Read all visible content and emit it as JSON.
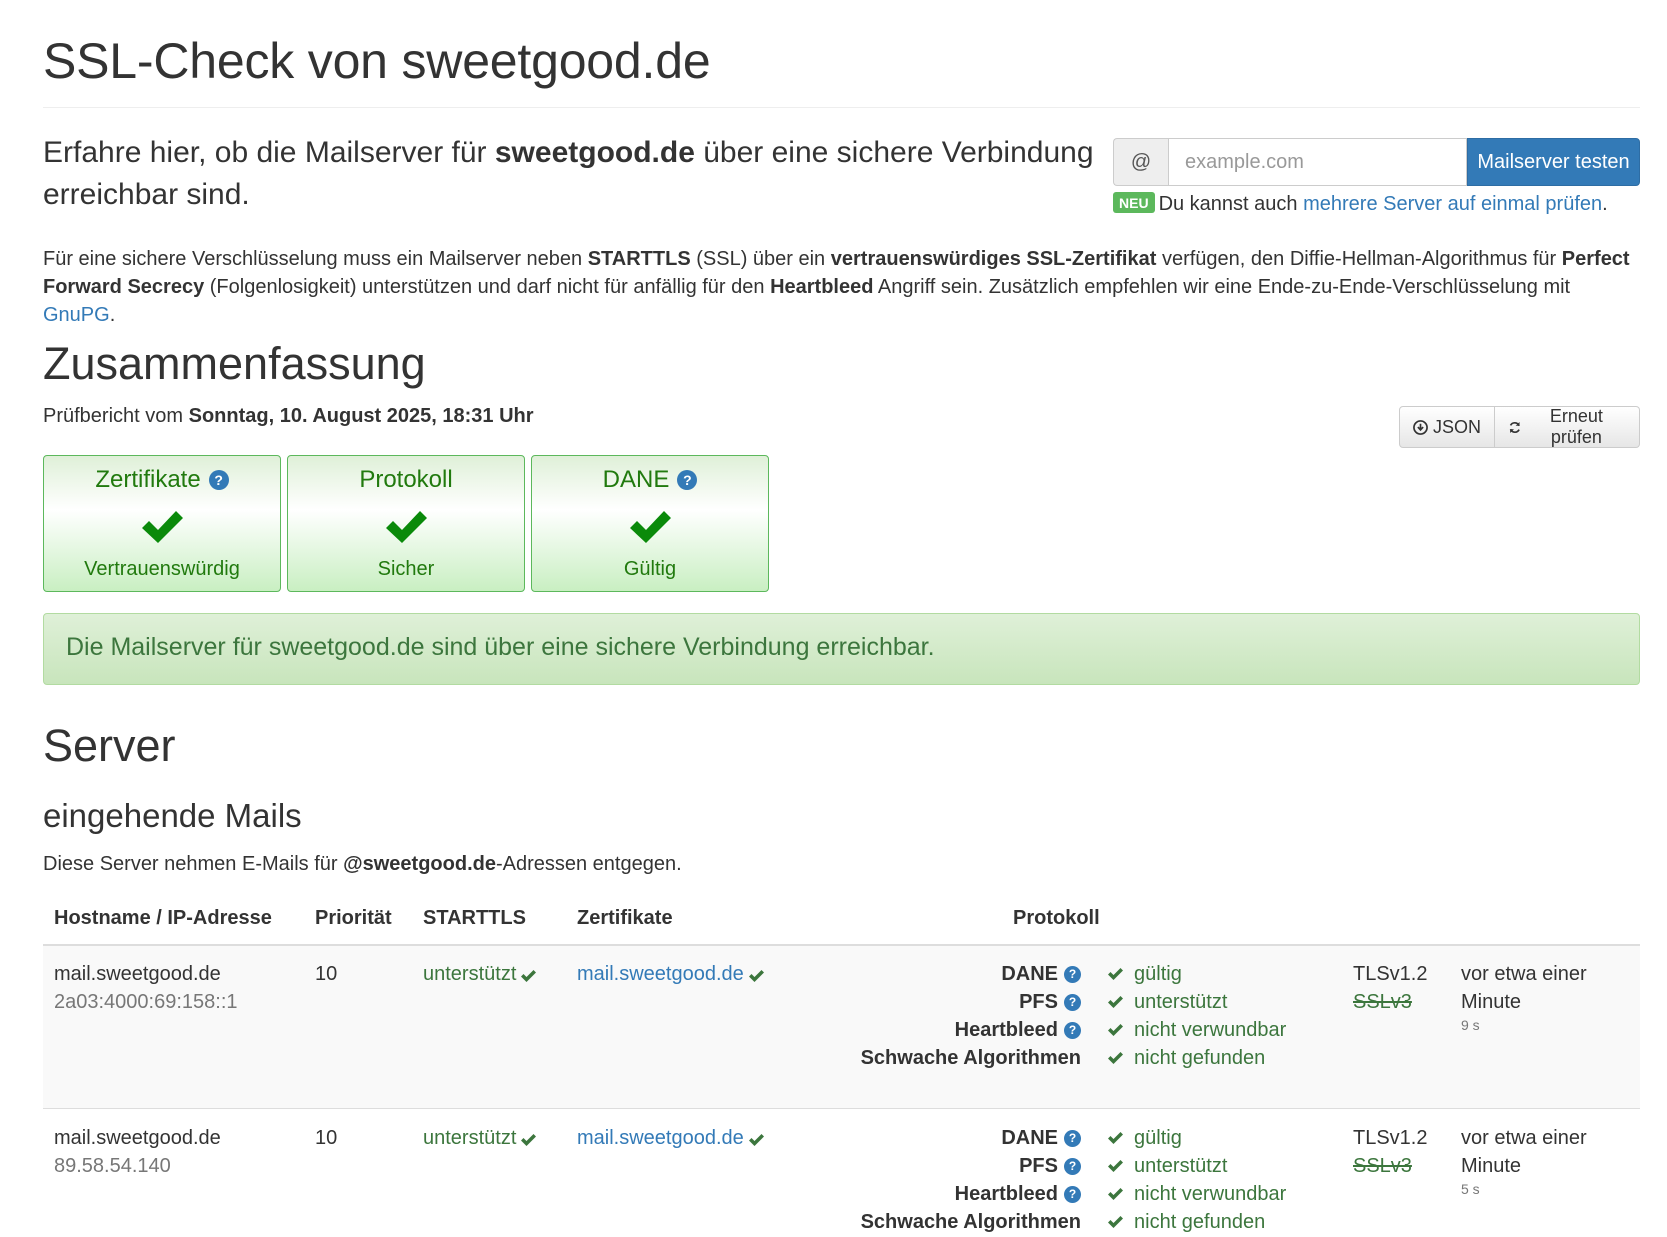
{
  "title": "SSL-Check von sweetgood.de",
  "lead": {
    "prefix": "Erfahre hier, ob die Mailserver für ",
    "domain": "sweetgood.de",
    "suffix": " über eine sichere Verbindung erreichbar sind."
  },
  "check_form": {
    "addon": "@",
    "placeholder": "example.com",
    "value": "",
    "button": "Mailserver testen",
    "new_badge": "NEU",
    "hint_prefix": "Du kannst auch ",
    "hint_link": "mehrere Server auf einmal prüfen",
    "hint_suffix": "."
  },
  "intro": {
    "t1": "Für eine sichere Verschlüsselung muss ein Mailserver neben ",
    "b1": "STARTTLS",
    "t2": " (SSL) über ein ",
    "b2": "vertrauenswürdiges SSL-Zertifikat",
    "t3": " verfügen, den Diffie-Hellman-Algorithmus für ",
    "b3": "Perfect Forward Secrecy",
    "t4": " (Folgenlosigkeit) unterstützen und darf nicht für anfällig für den ",
    "b4": "Heartbleed",
    "t5": " Angriff sein. Zusätzlich empfehlen wir eine Ende-zu-Ende-Verschlüsselung mit ",
    "link": "GnuPG",
    "t6": "."
  },
  "summary": {
    "heading": "Zusammenfassung",
    "report_prefix": "Prüfbericht vom ",
    "report_date": "Sonntag, 10. August 2025, 18:31 Uhr",
    "btn_json": "JSON",
    "btn_recheck": "Erneut prüfen",
    "panels": [
      {
        "title": "Zertifikate",
        "status": "Vertrauenswürdig",
        "help": true
      },
      {
        "title": "Protokoll",
        "status": "Sicher",
        "help": false
      },
      {
        "title": "DANE",
        "status": "Gültig",
        "help": true
      }
    ],
    "alert": "Die Mailserver für sweetgood.de sind über eine sichere Verbindung erreichbar."
  },
  "server": {
    "heading": "Server",
    "incoming_heading": "eingehende Mails",
    "incoming_desc_prefix": "Diese Server nehmen E-Mails für ",
    "incoming_desc_domain": "@sweetgood.de",
    "incoming_desc_suffix": "-Adressen entgegen.",
    "columns": [
      "Hostname / IP-Adresse",
      "Priorität",
      "STARTTLS",
      "Zertifikate",
      "Protokoll"
    ],
    "rows": [
      {
        "hostname": "mail.sweetgood.de",
        "ip": "2a03:4000:69:158::1",
        "priority": "10",
        "starttls": "unterstützt",
        "certificate": "mail.sweetgood.de",
        "checks": [
          {
            "label": "DANE",
            "value": "gültig"
          },
          {
            "label": "PFS",
            "value": "unterstützt"
          },
          {
            "label": "Heartbleed",
            "value": "nicht verwundbar"
          },
          {
            "label": "Schwache Algorithmen",
            "value": "nicht gefunden"
          }
        ],
        "tls": "TLSv1.2",
        "ssl": "SSLv3",
        "time": "vor etwa einer Minute",
        "duration": "9 s"
      },
      {
        "hostname": "mail.sweetgood.de",
        "ip": "89.58.54.140",
        "priority": "10",
        "starttls": "unterstützt",
        "certificate": "mail.sweetgood.de",
        "checks": [
          {
            "label": "DANE",
            "value": "gültig"
          },
          {
            "label": "PFS",
            "value": "unterstützt"
          },
          {
            "label": "Heartbleed",
            "value": "nicht verwundbar"
          },
          {
            "label": "Schwache Algorithmen",
            "value": "nicht gefunden"
          }
        ],
        "tls": "TLSv1.2",
        "ssl": "SSLv3",
        "time": "vor etwa einer Minute",
        "duration": "5 s"
      }
    ]
  },
  "colors": {
    "primary": "#337ab7",
    "success": "#3c763d",
    "success_check": "#1f8a1f"
  }
}
